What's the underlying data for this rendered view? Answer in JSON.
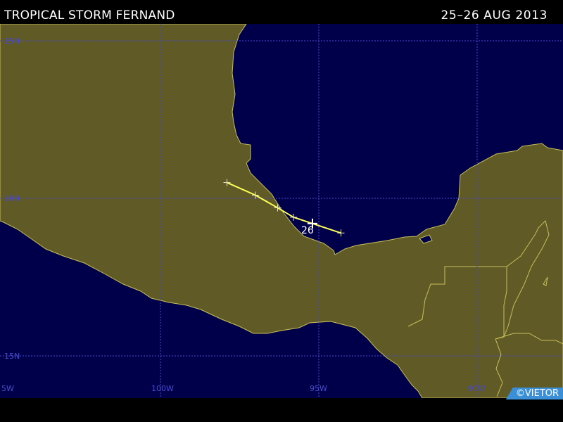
{
  "header": {
    "storm_name": "TROPICAL STORM FERNAND",
    "date_range": "25–26 AUG 2013"
  },
  "grid": {
    "lat_labels": [
      "25N",
      "20N",
      "15N"
    ],
    "lon_labels": [
      "5W",
      "100W",
      "95W",
      "90W"
    ]
  },
  "track": {
    "day_label": "26",
    "points": [
      {
        "lon": -97.9,
        "lat": 20.5
      },
      {
        "lon": -97.0,
        "lat": 20.1
      },
      {
        "lon": -96.3,
        "lat": 19.7
      },
      {
        "lon": -95.8,
        "lat": 19.4
      },
      {
        "lon": -95.2,
        "lat": 19.2
      },
      {
        "lon": -94.3,
        "lat": 18.9
      }
    ]
  },
  "credit": "©VIETOR",
  "colors": {
    "ocean": "#00004a",
    "land": "#5f5a26",
    "coast": "#c8bf5a",
    "grid": "#4a4acd",
    "track": "#ffff5a"
  }
}
